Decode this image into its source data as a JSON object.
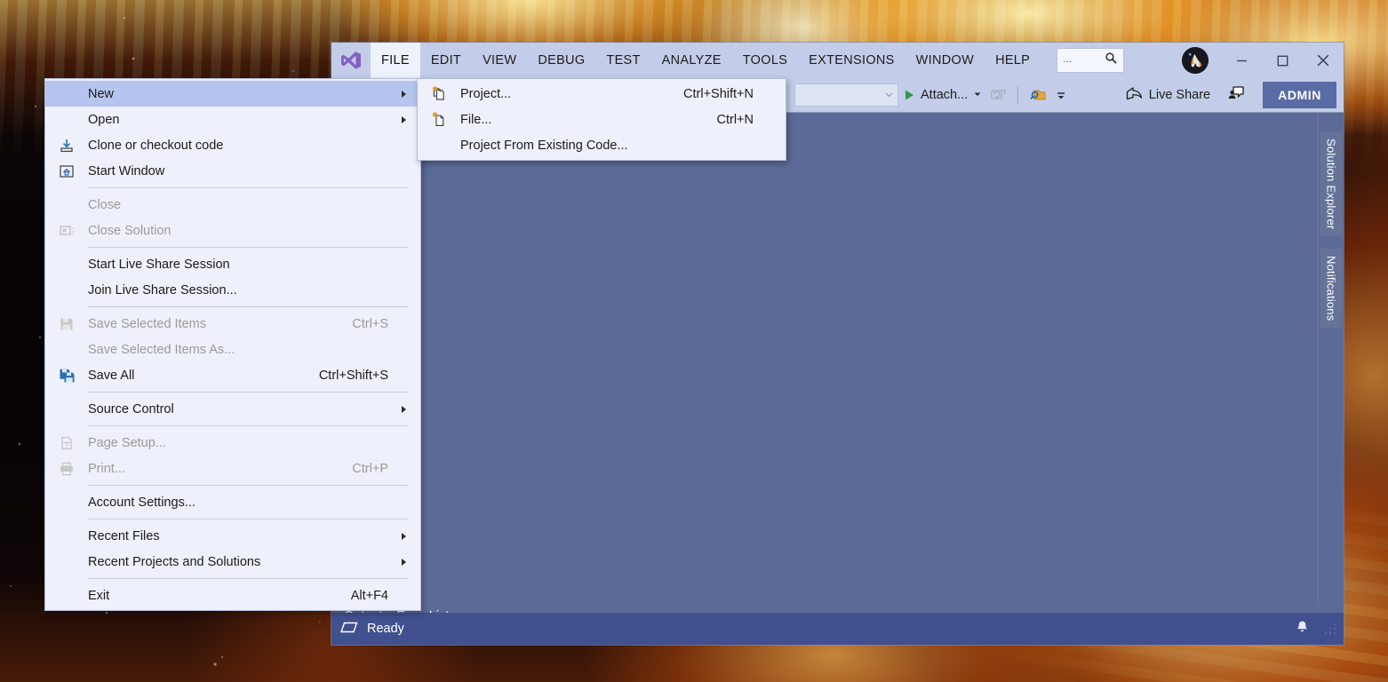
{
  "window": {
    "logo": "visual-studio-logo",
    "menubar": [
      "FILE",
      "EDIT",
      "VIEW",
      "DEBUG",
      "TEST",
      "ANALYZE",
      "TOOLS",
      "EXTENSIONS",
      "WINDOW",
      "HELP"
    ],
    "active_menu": "FILE",
    "quick_launch": {
      "placeholder": "...",
      "icon": "search-icon"
    },
    "controls": {
      "minimize": "─",
      "maximize": "☐",
      "close": "✕"
    }
  },
  "toolbar": {
    "config_combo_value": "",
    "attach_label": "Attach...",
    "live_share_label": "Live Share",
    "admin_label": "ADMIN"
  },
  "file_menu": {
    "items": [
      {
        "label": "New",
        "key": "",
        "icon": "",
        "submenu": true,
        "disabled": false,
        "selected": true,
        "sep_after": false
      },
      {
        "label": "Open",
        "key": "",
        "icon": "",
        "submenu": true,
        "disabled": false,
        "selected": false,
        "sep_after": false
      },
      {
        "label": "Clone or checkout code",
        "key": "",
        "icon": "clone-icon",
        "submenu": false,
        "disabled": false,
        "selected": false,
        "sep_after": false
      },
      {
        "label": "Start Window",
        "key": "",
        "icon": "start-window-icon",
        "submenu": false,
        "disabled": false,
        "selected": false,
        "sep_after": true
      },
      {
        "label": "Close",
        "key": "",
        "icon": "",
        "submenu": false,
        "disabled": true,
        "selected": false,
        "sep_after": false
      },
      {
        "label": "Close Solution",
        "key": "",
        "icon": "close-solution-icon",
        "submenu": false,
        "disabled": true,
        "selected": false,
        "sep_after": true
      },
      {
        "label": "Start Live Share Session",
        "key": "",
        "icon": "",
        "submenu": false,
        "disabled": false,
        "selected": false,
        "sep_after": false
      },
      {
        "label": "Join Live Share Session...",
        "key": "",
        "icon": "",
        "submenu": false,
        "disabled": false,
        "selected": false,
        "sep_after": true
      },
      {
        "label": "Save Selected Items",
        "key": "Ctrl+S",
        "icon": "save-icon",
        "submenu": false,
        "disabled": true,
        "selected": false,
        "sep_after": false
      },
      {
        "label": "Save Selected Items As...",
        "key": "",
        "icon": "",
        "submenu": false,
        "disabled": true,
        "selected": false,
        "sep_after": false
      },
      {
        "label": "Save All",
        "key": "Ctrl+Shift+S",
        "icon": "save-all-icon",
        "submenu": false,
        "disabled": false,
        "selected": false,
        "sep_after": true
      },
      {
        "label": "Source Control",
        "key": "",
        "icon": "",
        "submenu": true,
        "disabled": false,
        "selected": false,
        "sep_after": true
      },
      {
        "label": "Page Setup...",
        "key": "",
        "icon": "page-setup-icon",
        "submenu": false,
        "disabled": true,
        "selected": false,
        "sep_after": false
      },
      {
        "label": "Print...",
        "key": "Ctrl+P",
        "icon": "printer-icon",
        "submenu": false,
        "disabled": true,
        "selected": false,
        "sep_after": true
      },
      {
        "label": "Account Settings...",
        "key": "",
        "icon": "",
        "submenu": false,
        "disabled": false,
        "selected": false,
        "sep_after": true
      },
      {
        "label": "Recent Files",
        "key": "",
        "icon": "",
        "submenu": true,
        "disabled": false,
        "selected": false,
        "sep_after": false
      },
      {
        "label": "Recent Projects and Solutions",
        "key": "",
        "icon": "",
        "submenu": true,
        "disabled": false,
        "selected": false,
        "sep_after": true
      },
      {
        "label": "Exit",
        "key": "Alt+F4",
        "icon": "",
        "submenu": false,
        "disabled": false,
        "selected": false,
        "sep_after": false
      }
    ]
  },
  "new_submenu": {
    "items": [
      {
        "label": "Project...",
        "key": "Ctrl+Shift+N",
        "icon": "new-project-icon",
        "disabled": false,
        "sep_after": false
      },
      {
        "label": "File...",
        "key": "Ctrl+N",
        "icon": "new-file-icon",
        "disabled": false,
        "sep_after": false
      },
      {
        "label": "Project From Existing Code...",
        "key": "",
        "icon": "",
        "disabled": false,
        "sep_after": false
      }
    ]
  },
  "right_rail": {
    "tabs": [
      "Solution Explorer",
      "Notifications"
    ]
  },
  "bottom_tabs": [
    "Output",
    "Error List"
  ],
  "statusbar": {
    "text": "Ready",
    "icon": "parallelogram-icon",
    "bell": "bell-icon"
  },
  "colors": {
    "chrome": "#c3cde9",
    "menu_bg": "#eef1fb",
    "menu_selected": "#b5c5ef",
    "workarea": "#5c6a98",
    "statusbar": "#41518f",
    "admin_badge": "#5a6ba6",
    "vs_purple": "#8661c5"
  }
}
